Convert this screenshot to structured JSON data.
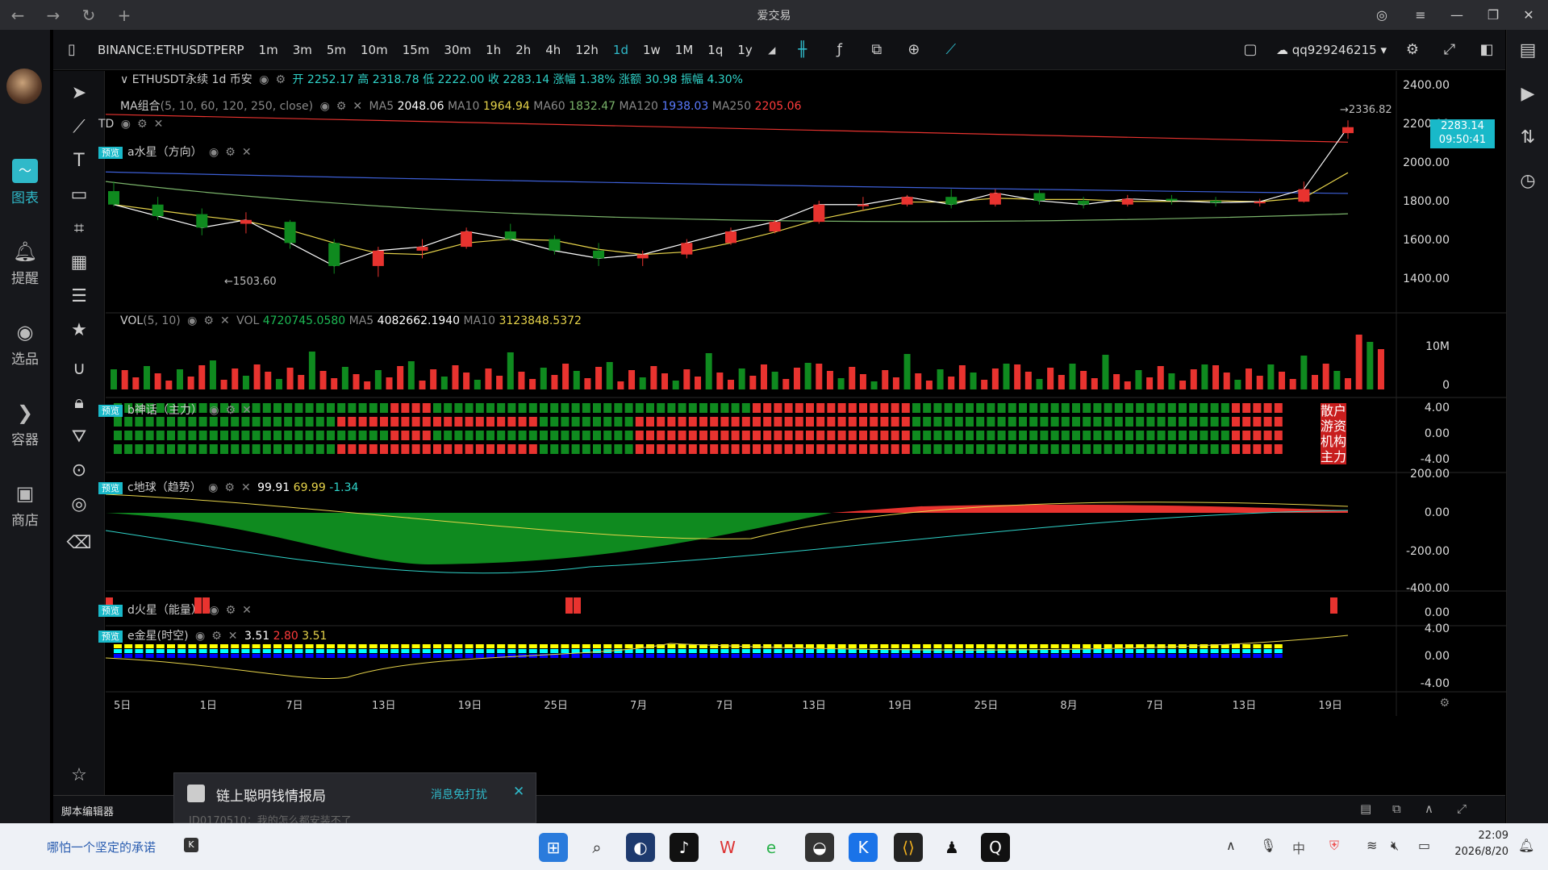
{
  "window": {
    "title": "爱交易"
  },
  "leftnav": [
    {
      "label": "图表",
      "icon": "chart-icon"
    },
    {
      "label": "提醒",
      "icon": "bell-icon"
    },
    {
      "label": "选品",
      "icon": "analytics-icon"
    },
    {
      "label": "容器",
      "icon": "container-icon"
    },
    {
      "label": "商店",
      "icon": "shop-icon"
    }
  ],
  "toolbar": {
    "symbol": "BINANCE:ETHUSDTPERP",
    "intervals": [
      "1m",
      "3m",
      "5m",
      "10m",
      "15m",
      "30m",
      "1h",
      "2h",
      "4h",
      "12h",
      "1d",
      "1w",
      "1M",
      "1q",
      "1y"
    ],
    "selected": "1d",
    "user": "qq929246215"
  },
  "legend": {
    "title": "ETHUSDT永续",
    "interval": "1d",
    "exchange": "币安",
    "ohlc": "开 2252.17 高 2318.78 低 2222.00 收 2283.14 涨幅 1.38% 涨额 30.98 振幅 4.30%",
    "ma_label": "MA组合",
    "ma_params": "(5, 10, 60, 120, 250, close)",
    "ma": [
      {
        "name": "MA5",
        "value": "2048.06",
        "color": "#ffffff"
      },
      {
        "name": "MA10",
        "value": "1964.94",
        "color": "#e6d34a"
      },
      {
        "name": "MA60",
        "value": "1832.47",
        "color": "#7ab36a"
      },
      {
        "name": "MA120",
        "value": "1938.03",
        "color": "#3d5fd6"
      },
      {
        "name": "MA250",
        "value": "2205.06",
        "color": "#ff3b3b"
      }
    ],
    "td": "TD",
    "a_label": "a水星（方向）",
    "preview": "预览"
  },
  "price_axis": [
    "2400.00",
    "2200.00",
    "2000.00",
    "1800.00",
    "1600.00",
    "1400.00"
  ],
  "price_current": {
    "value": "2283.14",
    "countdown": "09:50:41"
  },
  "annotations": {
    "high": "2336.82",
    "low": "1503.60"
  },
  "vol": {
    "label": "VOL",
    "params": "(5, 10)",
    "vol": "4720745.0580",
    "ma5": "4082662.1940",
    "ma10": "3123848.5372",
    "axis": [
      "10M",
      "0"
    ]
  },
  "b_panel": {
    "label": "b神话（主力）",
    "axis": [
      "4.00",
      "0.00",
      "-4.00"
    ],
    "row_labels": [
      "散户",
      "游资",
      "机构",
      "主力"
    ]
  },
  "c_panel": {
    "label": "c地球（趋势）",
    "v1": "99.91",
    "v2": "69.99",
    "v3": "-1.34",
    "axis": [
      "200.00",
      "0.00",
      "-200.00",
      "-400.00"
    ]
  },
  "d_panel": {
    "label": "d火星（能量）",
    "axis": [
      "0.00"
    ]
  },
  "e_panel": {
    "label": "e金星(时空)",
    "v1": "3.51",
    "v2": "2.80",
    "v3": "3.51",
    "axis": [
      "4.00",
      "0.00",
      "-4.00"
    ]
  },
  "date_axis": [
    "5日",
    "1日",
    "7日",
    "13日",
    "19日",
    "25日",
    "7月",
    "7日",
    "13日",
    "19日",
    "25日",
    "8月",
    "7日",
    "13日",
    "19日"
  ],
  "bottom": {
    "script_editor": "脚本编辑器"
  },
  "toast": {
    "title": "链上聪明钱情报局",
    "action": "消息免打扰",
    "body": "ID0170510：我的怎么都安装不了"
  },
  "taskbar": {
    "text": "哪怕一个坚定的承诺",
    "time": "22:09",
    "date": "2026/8/20"
  },
  "colors": {
    "accent": "#19b9c9",
    "up": "#e8332f",
    "down": "#0f8a1f",
    "yellow": "#e6d34a"
  },
  "chart_data": {
    "type": "candlestick",
    "price_range": [
      1400,
      2450
    ],
    "candles": [
      {
        "date": "2022-05-31",
        "open": 1950,
        "high": 2000,
        "low": 1870,
        "close": 1880
      },
      {
        "date": "2022-06-01",
        "open": 1880,
        "high": 1920,
        "low": 1800,
        "close": 1820
      },
      {
        "date": "2022-06-04",
        "open": 1830,
        "high": 1860,
        "low": 1720,
        "close": 1760
      },
      {
        "date": "2022-06-07",
        "open": 1780,
        "high": 1840,
        "low": 1730,
        "close": 1800
      },
      {
        "date": "2022-06-10",
        "open": 1790,
        "high": 1800,
        "low": 1650,
        "close": 1680
      },
      {
        "date": "2022-06-13",
        "open": 1680,
        "high": 1700,
        "low": 1520,
        "close": 1560
      },
      {
        "date": "2022-06-16",
        "open": 1560,
        "high": 1660,
        "low": 1503.6,
        "close": 1640
      },
      {
        "date": "2022-06-19",
        "open": 1640,
        "high": 1700,
        "low": 1600,
        "close": 1660
      },
      {
        "date": "2022-06-22",
        "open": 1660,
        "high": 1760,
        "low": 1650,
        "close": 1740
      },
      {
        "date": "2022-06-25",
        "open": 1740,
        "high": 1780,
        "low": 1690,
        "close": 1700
      },
      {
        "date": "2022-06-28",
        "open": 1700,
        "high": 1720,
        "low": 1620,
        "close": 1640
      },
      {
        "date": "2022-07-01",
        "open": 1640,
        "high": 1680,
        "low": 1560,
        "close": 1600
      },
      {
        "date": "2022-07-04",
        "open": 1600,
        "high": 1640,
        "low": 1560,
        "close": 1620
      },
      {
        "date": "2022-07-07",
        "open": 1620,
        "high": 1700,
        "low": 1600,
        "close": 1680
      },
      {
        "date": "2022-07-10",
        "open": 1680,
        "high": 1760,
        "low": 1670,
        "close": 1740
      },
      {
        "date": "2022-07-13",
        "open": 1740,
        "high": 1800,
        "low": 1730,
        "close": 1790
      },
      {
        "date": "2022-07-16",
        "open": 1790,
        "high": 1900,
        "low": 1780,
        "close": 1880
      },
      {
        "date": "2022-07-19",
        "open": 1880,
        "high": 1920,
        "low": 1850,
        "close": 1880
      },
      {
        "date": "2022-07-22",
        "open": 1880,
        "high": 1930,
        "low": 1870,
        "close": 1920
      },
      {
        "date": "2022-07-25",
        "open": 1920,
        "high": 1960,
        "low": 1860,
        "close": 1880
      },
      {
        "date": "2022-07-28",
        "open": 1880,
        "high": 1960,
        "low": 1870,
        "close": 1940
      },
      {
        "date": "2022-07-31",
        "open": 1940,
        "high": 1960,
        "low": 1880,
        "close": 1900
      },
      {
        "date": "2022-08-03",
        "open": 1900,
        "high": 1920,
        "low": 1860,
        "close": 1880
      },
      {
        "date": "2022-08-06",
        "open": 1880,
        "high": 1930,
        "low": 1870,
        "close": 1910
      },
      {
        "date": "2022-08-09",
        "open": 1910,
        "high": 1930,
        "low": 1880,
        "close": 1900
      },
      {
        "date": "2022-08-12",
        "open": 1900,
        "high": 1920,
        "low": 1870,
        "close": 1890
      },
      {
        "date": "2022-08-15",
        "open": 1890,
        "high": 1910,
        "low": 1870,
        "close": 1895
      },
      {
        "date": "2022-08-18",
        "open": 1895,
        "high": 2000,
        "low": 1890,
        "close": 1960
      },
      {
        "date": "2022-08-19",
        "open": 2252.17,
        "high": 2318.78,
        "low": 2222.0,
        "close": 2283.14
      }
    ],
    "indicators": [
      "MA5",
      "MA10",
      "MA60",
      "MA120",
      "MA250"
    ]
  }
}
